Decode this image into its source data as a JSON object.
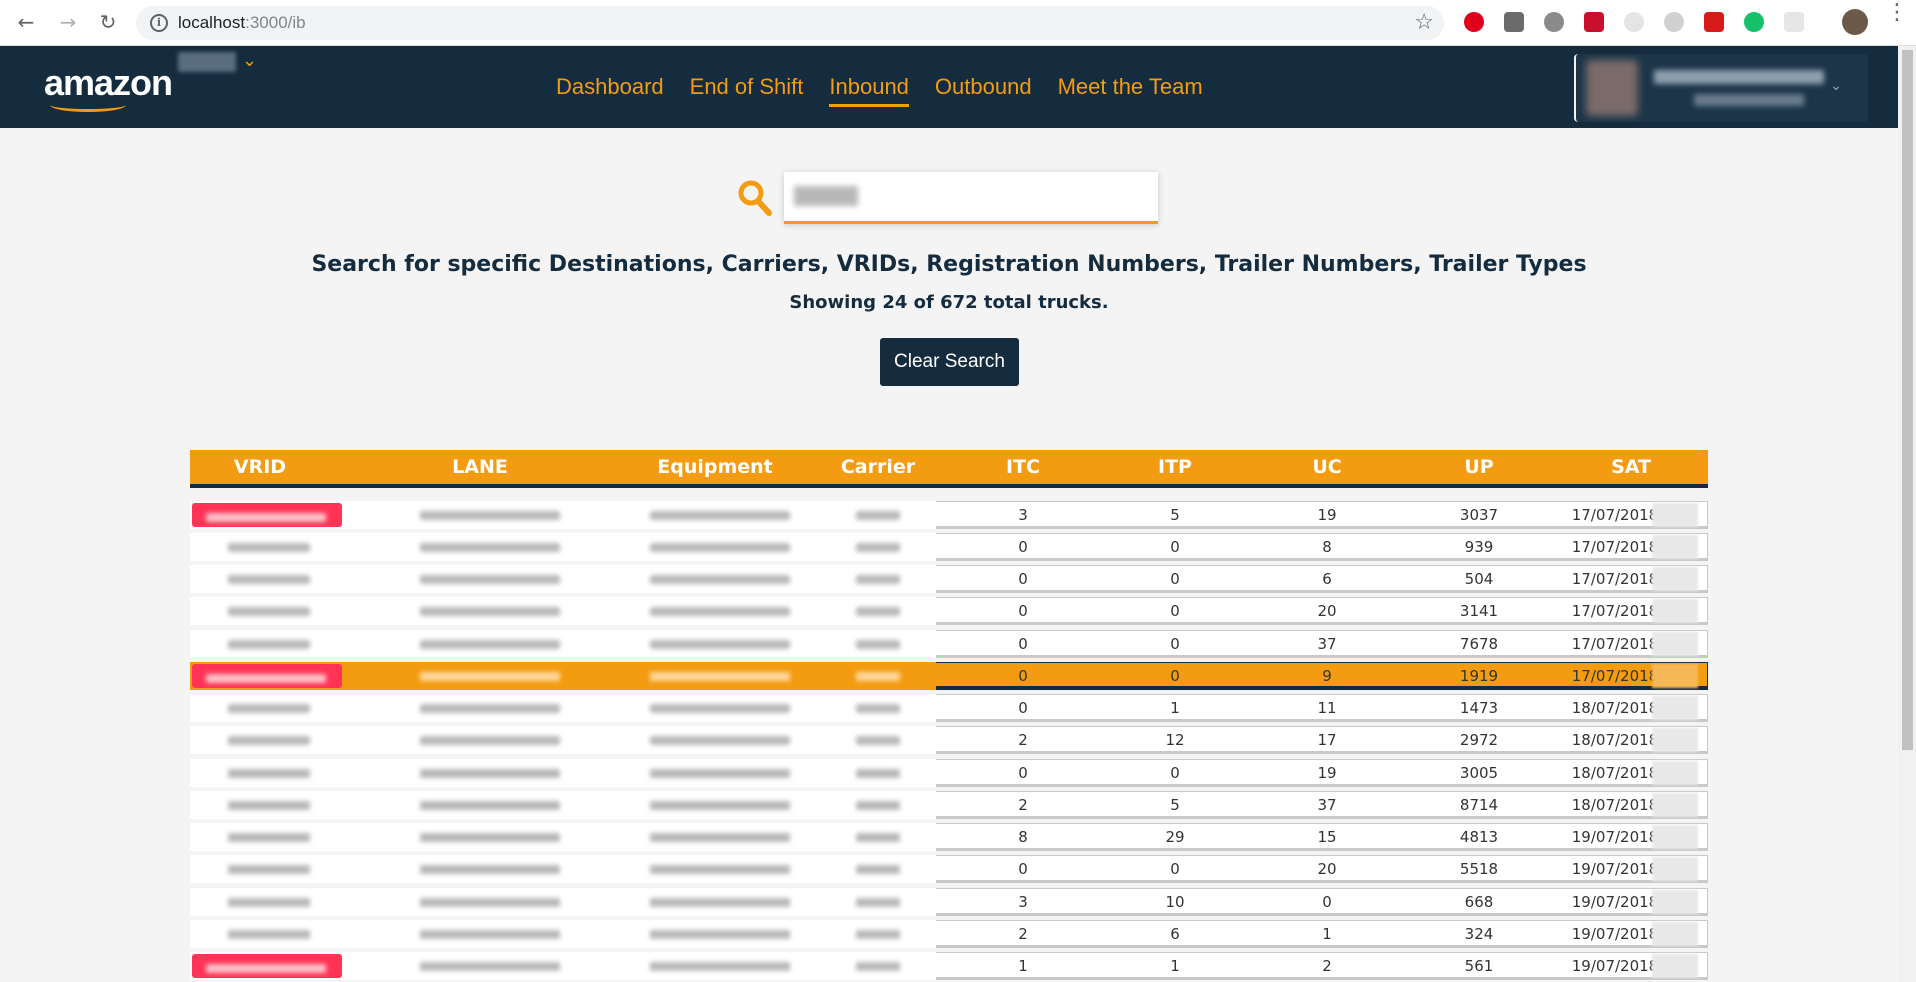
{
  "browser": {
    "url_host": "localhost",
    "url_path": ":3000/ib"
  },
  "app": {
    "logo_text": "amazon",
    "nav": [
      {
        "label": "Dashboard",
        "active": false
      },
      {
        "label": "End of Shift",
        "active": false
      },
      {
        "label": "Inbound",
        "active": true
      },
      {
        "label": "Outbound",
        "active": false
      },
      {
        "label": "Meet the Team",
        "active": false
      }
    ]
  },
  "search": {
    "headline": "Search for specific Destinations, Carriers, VRIDs, Registration Numbers, Trailer Numbers, Trailer Types",
    "summary": "Showing 24 of 672 total trucks.",
    "clear_label": "Clear Search"
  },
  "table": {
    "columns": [
      "VRID",
      "LANE",
      "Equipment",
      "Carrier",
      "ITC",
      "ITP",
      "UC",
      "UP",
      "SAT"
    ],
    "rows": [
      {
        "itc": "3",
        "itp": "5",
        "uc": "19",
        "up": "3037",
        "sat": "17/07/2018",
        "flag": true,
        "hl": false
      },
      {
        "itc": "0",
        "itp": "0",
        "uc": "8",
        "up": "939",
        "sat": "17/07/2018",
        "flag": false,
        "hl": false
      },
      {
        "itc": "0",
        "itp": "0",
        "uc": "6",
        "up": "504",
        "sat": "17/07/2018",
        "flag": false,
        "hl": false
      },
      {
        "itc": "0",
        "itp": "0",
        "uc": "20",
        "up": "3141",
        "sat": "17/07/2018",
        "flag": false,
        "hl": false
      },
      {
        "itc": "0",
        "itp": "0",
        "uc": "37",
        "up": "7678",
        "sat": "17/07/2018",
        "flag": false,
        "hl": false
      },
      {
        "itc": "0",
        "itp": "0",
        "uc": "9",
        "up": "1919",
        "sat": "17/07/2018",
        "flag": true,
        "hl": true
      },
      {
        "itc": "0",
        "itp": "1",
        "uc": "11",
        "up": "1473",
        "sat": "18/07/2018",
        "flag": false,
        "hl": false
      },
      {
        "itc": "2",
        "itp": "12",
        "uc": "17",
        "up": "2972",
        "sat": "18/07/2018",
        "flag": false,
        "hl": false
      },
      {
        "itc": "0",
        "itp": "0",
        "uc": "19",
        "up": "3005",
        "sat": "18/07/2018",
        "flag": false,
        "hl": false
      },
      {
        "itc": "2",
        "itp": "5",
        "uc": "37",
        "up": "8714",
        "sat": "18/07/2018",
        "flag": false,
        "hl": false
      },
      {
        "itc": "8",
        "itp": "29",
        "uc": "15",
        "up": "4813",
        "sat": "19/07/2018",
        "flag": false,
        "hl": false
      },
      {
        "itc": "0",
        "itp": "0",
        "uc": "20",
        "up": "5518",
        "sat": "19/07/2018",
        "flag": false,
        "hl": false
      },
      {
        "itc": "3",
        "itp": "10",
        "uc": "0",
        "up": "668",
        "sat": "19/07/2018",
        "flag": false,
        "hl": false
      },
      {
        "itc": "2",
        "itp": "6",
        "uc": "1",
        "up": "324",
        "sat": "19/07/2018",
        "flag": false,
        "hl": false
      },
      {
        "itc": "1",
        "itp": "1",
        "uc": "2",
        "up": "561",
        "sat": "19/07/2018",
        "flag": true,
        "hl": false
      }
    ]
  }
}
